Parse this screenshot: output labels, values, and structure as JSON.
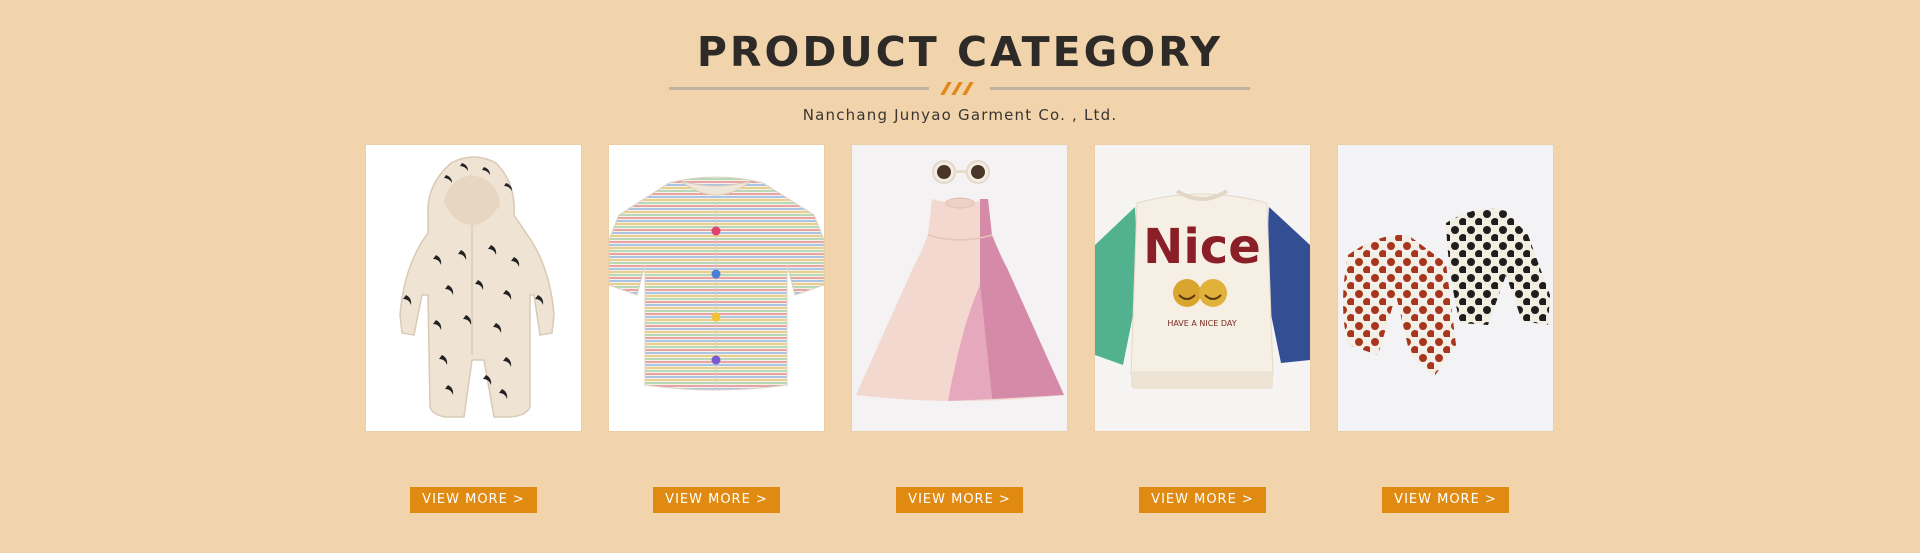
{
  "header": {
    "title": "PRODUCT CATEGORY",
    "subtitle": "Nanchang Junyao Garment Co. , Ltd."
  },
  "colors": {
    "background": "#f1d4ab",
    "accent": "#e08a12",
    "title": "#2d2a27"
  },
  "products": [
    {
      "image": "hooded-romper-moon-print",
      "button_label": "VIEW MORE >"
    },
    {
      "image": "striped-short-sleeve-cardigan",
      "button_label": "VIEW MORE >"
    },
    {
      "image": "pink-sleeveless-dress-with-sunglasses",
      "button_label": "VIEW MORE >"
    },
    {
      "image": "nice-smiley-sweatshirt",
      "button_label": "VIEW MORE >",
      "print_text": "Nice",
      "print_subtext": "HAVE A NICE DAY"
    },
    {
      "image": "polka-dot-pants-pair",
      "button_label": "VIEW MORE >"
    }
  ]
}
